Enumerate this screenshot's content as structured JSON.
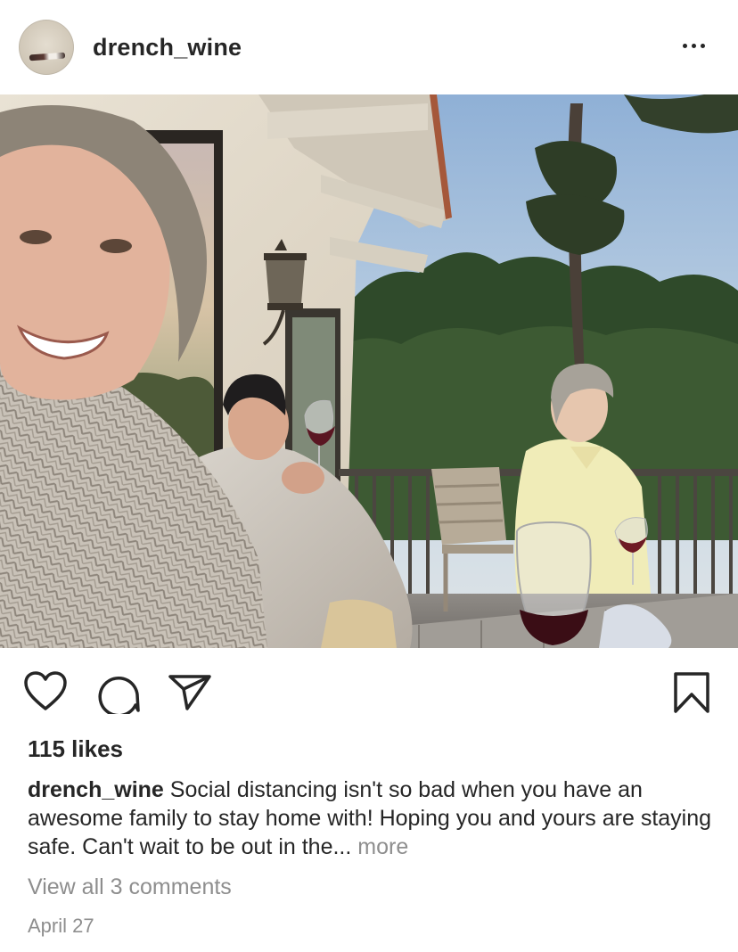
{
  "post": {
    "username": "drench_wine",
    "likes": "115 likes",
    "caption_text": "Social distancing isn't so bad when you have an awesome family to stay home with! Hoping you and yours are staying safe. Can't wait to be out in the...",
    "caption_more": "more",
    "view_comments": "View all 3 comments",
    "date": "April 27"
  },
  "icons": {
    "more": "more-horizontal-icon",
    "like": "heart-outline-icon",
    "comment": "comment-bubble-icon",
    "share": "paper-plane-icon",
    "save": "bookmark-outline-icon"
  },
  "colors": {
    "text": "#262626",
    "secondary_text": "#8e8e8e",
    "background": "#ffffff"
  }
}
